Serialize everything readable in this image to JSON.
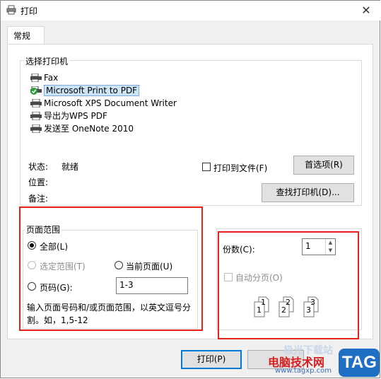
{
  "window": {
    "title": "打印",
    "close_glyph": "✕"
  },
  "tabs": [
    {
      "label": "常规"
    }
  ],
  "select_printer": {
    "group_label": "选择打印机",
    "printers": [
      {
        "name": "Fax",
        "icon": "fax-printer-icon",
        "selected": false
      },
      {
        "name": "Microsoft Print to PDF",
        "icon": "default-printer-icon",
        "selected": true
      },
      {
        "name": "Microsoft XPS Document Writer",
        "icon": "printer-icon",
        "selected": false
      },
      {
        "name": "导出为WPS PDF",
        "icon": "printer-icon",
        "selected": false
      },
      {
        "name": "发送至 OneNote 2010",
        "icon": "printer-icon",
        "selected": false
      }
    ],
    "status_label": "状态:",
    "status_value": "就绪",
    "location_label": "位置:",
    "comment_label": "备注:",
    "print_to_file_label": "打印到文件(F)",
    "preferences_button": "首选项(R)",
    "find_printer_button": "查找打印机(D)..."
  },
  "page_range": {
    "group_label": "页面范围",
    "all_label": "全部(L)",
    "selection_label": "选定范围(T)",
    "current_page_label": "当前页面(U)",
    "pages_label": "页码(G):",
    "pages_value": "1-3",
    "hint_line1": "输入页面号码和/或页面范围，以英文逗号分",
    "hint_line2": "割。如，1,5-12"
  },
  "copies": {
    "label": "份数(C):",
    "value": "1",
    "collate_label": "自动分页(O)",
    "collate_pages": [
      "1",
      "1",
      "2",
      "2",
      "3",
      "3"
    ]
  },
  "footer": {
    "print_button": "打印(P)",
    "watermark_site": "电脑技术网",
    "watermark_url": "www.tagxp.com",
    "watermark_tag": "TAG",
    "watermark_faded": "极光下载站"
  },
  "colors": {
    "highlight": "#e8211b",
    "accent": "#0078d7",
    "selection": "#cce4f7"
  }
}
